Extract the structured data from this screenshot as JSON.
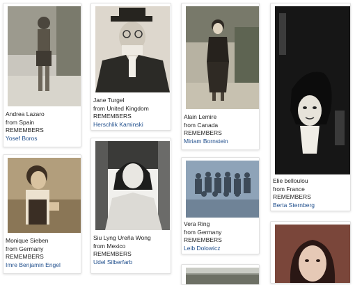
{
  "cards": [
    {
      "name": "Andrea Lazaro",
      "origin": "from Spain",
      "remembers": "REMEMBERS",
      "remembered": "Yosef Boros"
    },
    {
      "name": "Jane Turgel",
      "origin": "from United Kingdom",
      "remembers": "REMEMBERS",
      "remembered": "Herschlik Kaminski"
    },
    {
      "name": "Alain Lemire",
      "origin": "from Canada",
      "remembers": "REMEMBERS",
      "remembered": "Miriam Bornstein"
    },
    {
      "name": "Elie belloulou",
      "origin": "from France",
      "remembers": "REMEMBERS",
      "remembered": "Berta Sternberg"
    },
    {
      "name": "Monique Sieben",
      "origin": "from Germany",
      "remembers": "REMEMBERS",
      "remembered": "Imre Benjamin Engel"
    },
    {
      "name": "Siu Lyng Ureña Wong",
      "origin": "from Mexico",
      "remembers": "REMEMBERS",
      "remembered": "Udel Silberfarb"
    },
    {
      "name": "Vera Ring",
      "origin": "from Germany",
      "remembers": "REMEMBERS",
      "remembered": "Leib Dolowicz"
    },
    {
      "name": "",
      "origin": "",
      "remembers": "",
      "remembered": ""
    },
    {
      "name": "",
      "origin": "",
      "remembers": "",
      "remembered": ""
    }
  ],
  "colors": {
    "link": "#1f4e8c",
    "text": "#222222",
    "card_border": "#e1e1e1"
  }
}
